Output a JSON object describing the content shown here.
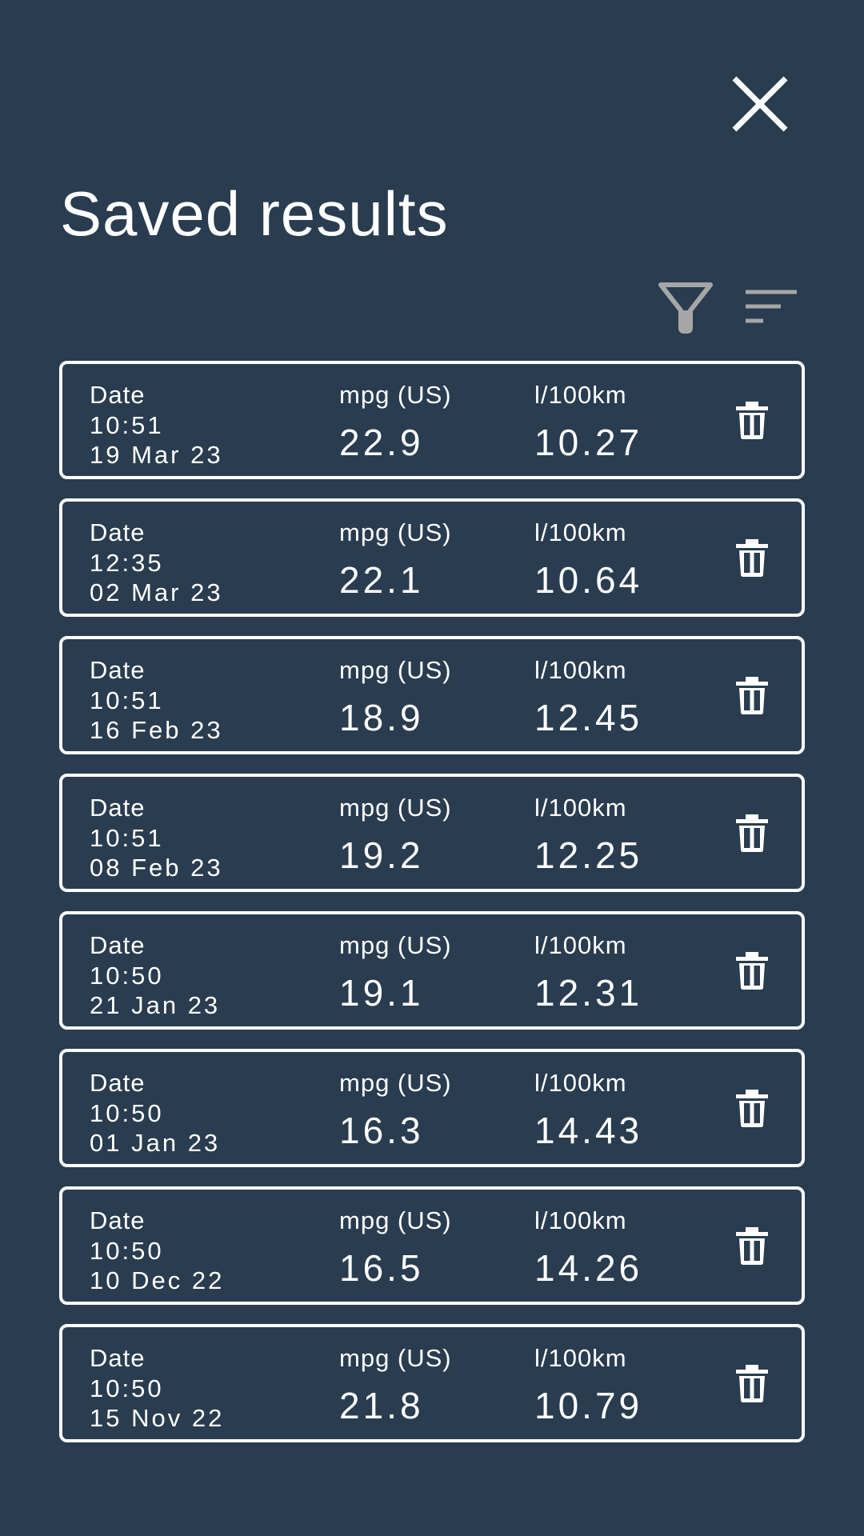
{
  "header": {
    "title": "Saved results",
    "close_icon": "close-icon",
    "filter_icon": "filter-icon",
    "sort_icon": "sort-icon"
  },
  "colors": {
    "background": "#2a3c4f",
    "text": "#ffffff",
    "toolbar_icon": "#a6a6a6"
  },
  "results": [
    {
      "date_label": "Date",
      "time": "10:51",
      "date": "19 Mar 23",
      "mpg_label": "mpg (US)",
      "mpg": "22.9",
      "lkm_label": "l/100km",
      "lkm": "10.27",
      "delete_icon": "trash-icon"
    },
    {
      "date_label": "Date",
      "time": "12:35",
      "date": "02 Mar 23",
      "mpg_label": "mpg (US)",
      "mpg": "22.1",
      "lkm_label": "l/100km",
      "lkm": "10.64",
      "delete_icon": "trash-icon"
    },
    {
      "date_label": "Date",
      "time": "10:51",
      "date": "16 Feb 23",
      "mpg_label": "mpg (US)",
      "mpg": "18.9",
      "lkm_label": "l/100km",
      "lkm": "12.45",
      "delete_icon": "trash-icon"
    },
    {
      "date_label": "Date",
      "time": "10:51",
      "date": "08 Feb 23",
      "mpg_label": "mpg (US)",
      "mpg": "19.2",
      "lkm_label": "l/100km",
      "lkm": "12.25",
      "delete_icon": "trash-icon"
    },
    {
      "date_label": "Date",
      "time": "10:50",
      "date": "21 Jan 23",
      "mpg_label": "mpg (US)",
      "mpg": "19.1",
      "lkm_label": "l/100km",
      "lkm": "12.31",
      "delete_icon": "trash-icon"
    },
    {
      "date_label": "Date",
      "time": "10:50",
      "date": "01 Jan 23",
      "mpg_label": "mpg (US)",
      "mpg": "16.3",
      "lkm_label": "l/100km",
      "lkm": "14.43",
      "delete_icon": "trash-icon"
    },
    {
      "date_label": "Date",
      "time": "10:50",
      "date": "10 Dec 22",
      "mpg_label": "mpg (US)",
      "mpg": "16.5",
      "lkm_label": "l/100km",
      "lkm": "14.26",
      "delete_icon": "trash-icon"
    },
    {
      "date_label": "Date",
      "time": "10:50",
      "date": "15 Nov 22",
      "mpg_label": "mpg (US)",
      "mpg": "21.8",
      "lkm_label": "l/100km",
      "lkm": "10.79",
      "delete_icon": "trash-icon"
    }
  ]
}
